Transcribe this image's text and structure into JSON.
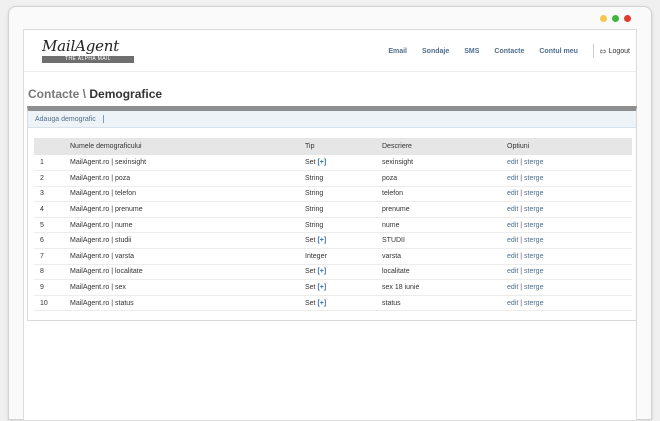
{
  "colors": {
    "link": "#4f6e8e",
    "traffic": [
      "#f4c84a",
      "#3fb53f",
      "#e03a2e"
    ],
    "panel_top": "#8e8e8e",
    "action_bg": "#eef3f8"
  },
  "logo": {
    "script": "MailAgent",
    "tagline": "THE ALPHA MAIL"
  },
  "nav": {
    "items": [
      "Email",
      "Sondaje",
      "SMS",
      "Contacte",
      "Contul meu"
    ],
    "logout_icon": "logout-icon",
    "logout": "Logout"
  },
  "page": {
    "crumb": "Contacte \\",
    "title": "Demografice"
  },
  "actionbar": {
    "add_label": "Adauga demografic"
  },
  "table": {
    "headers": [
      "",
      "Numele demograficului",
      "Tip",
      "Descriere",
      "Optiuni"
    ],
    "edit_label": "edit",
    "delete_label": "sterge",
    "plus_label": "[+]",
    "rows": [
      {
        "id": "1",
        "name": "MailAgent.ro | sexinsight",
        "type": "Set",
        "plus": true,
        "desc": "sexinsight"
      },
      {
        "id": "2",
        "name": "MailAgent.ro | poza",
        "type": "String",
        "plus": false,
        "desc": "poza"
      },
      {
        "id": "3",
        "name": "MailAgent.ro | telefon",
        "type": "String",
        "plus": false,
        "desc": "telefon"
      },
      {
        "id": "4",
        "name": "MailAgent.ro | prenume",
        "type": "String",
        "plus": false,
        "desc": "prenume"
      },
      {
        "id": "5",
        "name": "MailAgent.ro | nume",
        "type": "String",
        "plus": false,
        "desc": "nume"
      },
      {
        "id": "6",
        "name": "MailAgent.ro | studii",
        "type": "Set",
        "plus": true,
        "desc": "STUDII"
      },
      {
        "id": "7",
        "name": "MailAgent.ro | varsta",
        "type": "Integer",
        "plus": false,
        "desc": "varsta"
      },
      {
        "id": "8",
        "name": "MailAgent.ro | localitate",
        "type": "Set",
        "plus": true,
        "desc": "localitate"
      },
      {
        "id": "9",
        "name": "MailAgent.ro | sex",
        "type": "Set",
        "plus": true,
        "desc": "sex 18 iunie"
      },
      {
        "id": "10",
        "name": "MailAgent.ro | status",
        "type": "Set",
        "plus": true,
        "desc": "status"
      }
    ]
  }
}
